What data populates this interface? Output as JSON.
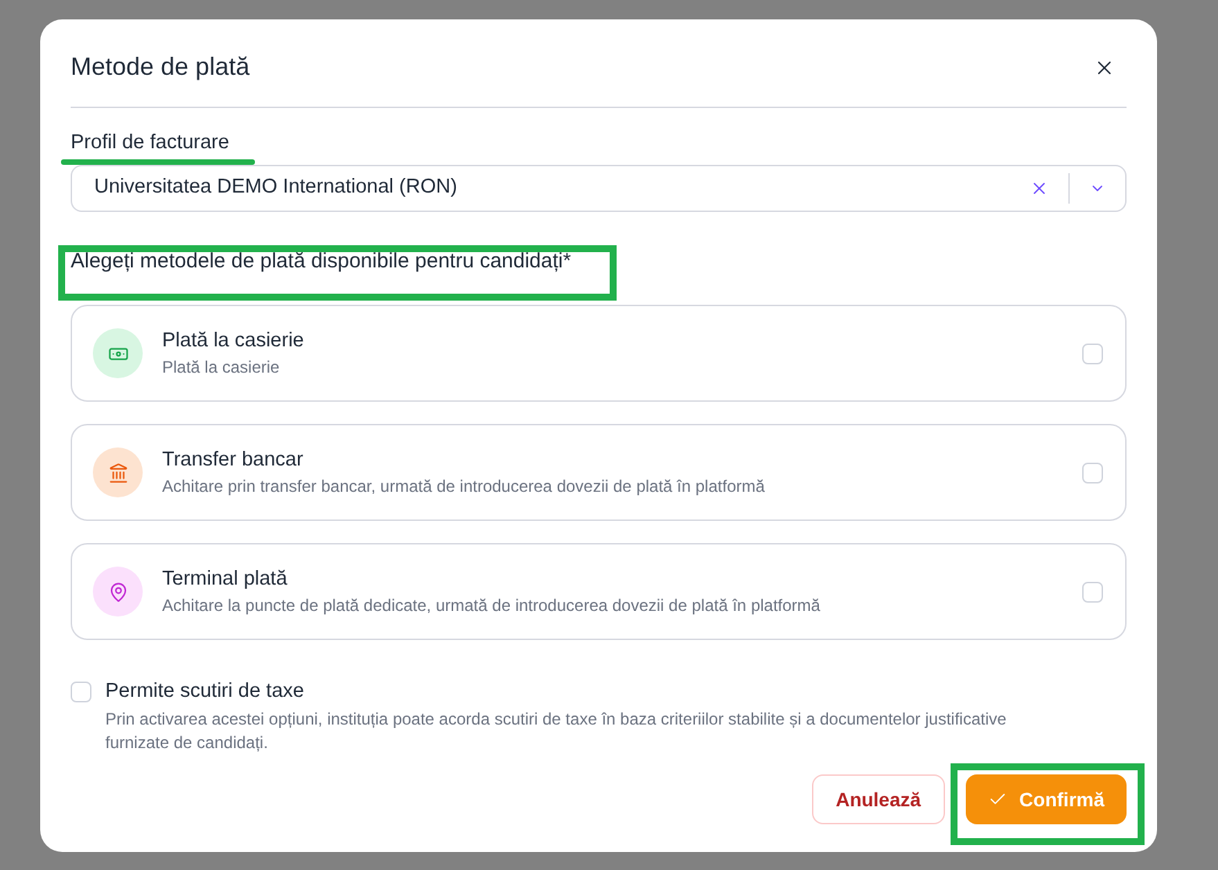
{
  "dialog": {
    "title": "Metode de plată"
  },
  "billing_profile": {
    "label": "Profil de facturare",
    "underlined": true,
    "value": "Universitatea DEMO International (RON)"
  },
  "methods_section": {
    "heading": "Alegeți metodele de plată disponibile pentru candidați*",
    "framed": true
  },
  "methods": [
    {
      "kind": "cash",
      "title": "Plată la casierie",
      "description": "Plată la casierie",
      "checked": false
    },
    {
      "kind": "bank",
      "title": "Transfer bancar",
      "description": "Achitare prin transfer bancar, urmată de introducerea dovezii de plată în platformă",
      "checked": false
    },
    {
      "kind": "terminal",
      "title": "Terminal plată",
      "description": "Achitare la puncte de plată dedicate, urmată de introducerea dovezii de plată în platformă",
      "checked": false
    }
  ],
  "tax_exemption": {
    "label": "Permite scutiri de taxe",
    "description": "Prin activarea acestei opțiuni, instituția poate acorda scutiri de taxe în baza criteriilor stabilite și a documentelor justificative furnizate de candidați.",
    "checked": false
  },
  "buttons": [
    {
      "kind": "cancel",
      "label": "Anulează",
      "framed": false
    },
    {
      "kind": "confirm",
      "label": "Confirmă",
      "framed": true
    }
  ]
}
